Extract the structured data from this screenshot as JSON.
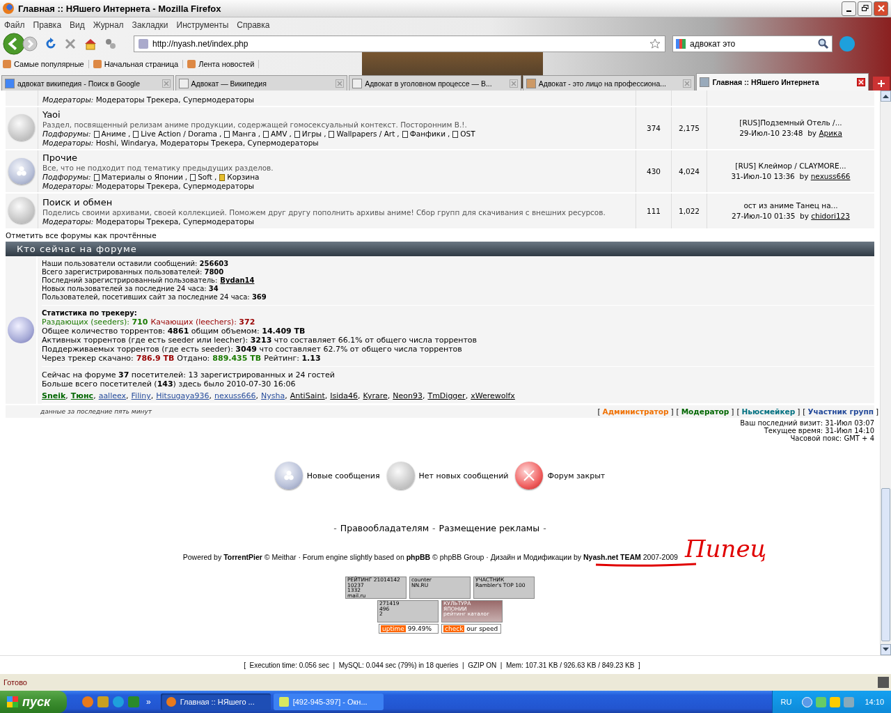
{
  "window": {
    "title": "Главная :: НЯшего Интернета - Mozilla Firefox"
  },
  "menu": [
    "Файл",
    "Правка",
    "Вид",
    "Журнал",
    "Закладки",
    "Инструменты",
    "Справка"
  ],
  "address": "http://nyash.net/index.php",
  "search": {
    "value": "адвокат это"
  },
  "bookmarks": [
    "Самые популярные",
    "Начальная страница",
    "Лента новостей"
  ],
  "tabs": [
    {
      "label": "адвокат википедия - Поиск в Google",
      "selected": false
    },
    {
      "label": "Адвокат — Википедия",
      "selected": false
    },
    {
      "label": "Адвокат в уголовном процессе — В...",
      "selected": false
    },
    {
      "label": "Адвокат - это лицо на профессиона...",
      "selected": false
    },
    {
      "label": "Главная :: НЯшего Интернета",
      "selected": true
    }
  ],
  "partial_row": {
    "moderators_label": "Модераторы:",
    "moderators": "Модераторы Трекера, Супермодераторы"
  },
  "forums": [
    {
      "unread": false,
      "title": "Yaoi",
      "description": "Раздел, посвященный релизам аниме продукции, содержащей гомосексуальный контекст. Посторонним В.!.",
      "subforums_label": "Подфорумы:",
      "subforums": [
        {
          "name": "Аниме",
          "sep": ",",
          "kind": "doc"
        },
        {
          "name": "Live Action / Dorama",
          "sep": ",",
          "kind": "doc"
        },
        {
          "name": "Манга",
          "sep": ",",
          "kind": "doc"
        },
        {
          "name": "AMV",
          "sep": ",",
          "kind": "doc"
        },
        {
          "name": "Игры",
          "sep": ",",
          "kind": "doc"
        },
        {
          "name": "Wallpapers / Art",
          "sep": ",",
          "kind": "doc"
        },
        {
          "name": "Фанфики",
          "sep": ",",
          "kind": "doc"
        },
        {
          "name": "OST",
          "kind": "doc"
        }
      ],
      "moderators_label": "Модераторы:",
      "moderators": "Hoshi, Windarya, Модераторы Трекера, Супермодераторы",
      "topics": "374",
      "posts": "2,175",
      "last_title": "[RUS]Подземный Отель /...",
      "last_date": "29-Июл-10 23:48",
      "last_by": "by",
      "last_author": "Арика"
    },
    {
      "unread": true,
      "title": "Прочие",
      "description": "Все, что не подходит под тематику предыдущих разделов.",
      "subforums_label": "Подфорумы:",
      "subforums": [
        {
          "name": "Материалы о Японии",
          "sep": ",",
          "kind": "doc"
        },
        {
          "name": "Soft",
          "sep": ",",
          "kind": "doc"
        },
        {
          "name": "Корзина",
          "kind": "bin"
        }
      ],
      "moderators_label": "Модераторы:",
      "moderators": "Модераторы Трекера, Супермодераторы",
      "topics": "430",
      "posts": "4,024",
      "last_title": "[RUS] Клеймор / CLAYMORE...",
      "last_date": "31-Июл-10 13:36",
      "last_by": "by",
      "last_author": "nexuss666"
    },
    {
      "unread": false,
      "title": "Поиск и обмен",
      "description": "Поделись своими архивами, своей коллекцией. Поможем друг другу пополнить архивы аниме! Сбор групп для скачивания с внешних ресурсов.",
      "moderators_label": "Модераторы:",
      "moderators": "Модераторы Трекера, Супермодераторы",
      "topics": "111",
      "posts": "1,022",
      "last_title": "ост из аниме Танец на...",
      "last_date": "27-Июл-10 01:35",
      "last_by": "by",
      "last_author": "chidori123"
    }
  ],
  "mark_read": "Отметить все форумы как прочтённые",
  "online": {
    "title": "Кто сейчас на форуме",
    "stats": [
      {
        "text": "Наши пользователи оставили сообщений: **256603**"
      },
      {
        "text": "Всего зарегистрированных пользователей: **7800**"
      },
      {
        "text": "Последний зарегистрированный пользователь:",
        "link": "Bydan14"
      },
      {
        "text": "Новых пользователей за последние 24 часа: **34**"
      },
      {
        "text": "Пользователей, посетивших сайт за последние 24 часа: **369**"
      }
    ],
    "tracker_title": "Статистика по трекеру:",
    "tracker": [
      [
        {
          "text": "Раздающих (seeders): **710**",
          "color": "#1a7a00"
        },
        {
          "text": "Качающих (leechers): **372**",
          "color": "#990000"
        }
      ],
      [
        {
          "text": "Общее количество торрентов: **4861** общим объемом: **14.409 TB**",
          "color": "#000000"
        }
      ],
      [
        {
          "text": "Активных торрентов (где есть seeder или leecher): **3213** что составляет 66.1% от общего числа торрентов",
          "color": "#000000"
        }
      ],
      [
        {
          "text": "Поддерживаемых торрентов (где есть seeder): **3049** что составляет 62.7% от общего числа торрентов",
          "color": "#000000"
        }
      ],
      [
        {
          "text": "Через трекер скачано:",
          "color": "#000000"
        },
        {
          "text": "**786.9 TB**",
          "color": "#990000"
        },
        {
          "text": "Отдано:",
          "color": "#000000"
        },
        {
          "text": "**889.435 TB**",
          "color": "#1a7a00"
        },
        {
          "text": "Рейтинг: **1.13**",
          "color": "#000000"
        }
      ]
    ],
    "presence": [
      "Сейчас на форуме **37** посетителей: 13 зарегистрированных и 24 гостей",
      "Больше всего посетителей (**143**) здесь было 2010-07-30 16:06"
    ],
    "users": [
      {
        "name": "Sneik",
        "sep": ",",
        "color": "#006600",
        "bold": true
      },
      {
        "name": "Тюнс",
        "sep": ",",
        "color": "#006600",
        "bold": true
      },
      {
        "name": "aalleex",
        "sep": ",",
        "color": "#244a9a",
        "bold": false
      },
      {
        "name": "Filiny",
        "sep": ",",
        "color": "#244a9a",
        "bold": false
      },
      {
        "name": "Hitsugaya936",
        "sep": ",",
        "color": "#244a9a",
        "bold": false
      },
      {
        "name": "nexuss666",
        "sep": ",",
        "color": "#244a9a",
        "bold": false
      },
      {
        "name": "Nysha",
        "sep": ",",
        "color": "#244a9a",
        "bold": false
      },
      {
        "name": "AntiSaint",
        "sep": ",",
        "color": "#000000",
        "bold": false
      },
      {
        "name": "Isida46",
        "sep": ",",
        "color": "#000000",
        "bold": false
      },
      {
        "name": "Kyrare",
        "sep": ",",
        "color": "#000000",
        "bold": false
      },
      {
        "name": "Neon93",
        "sep": ",",
        "color": "#000000",
        "bold": false
      },
      {
        "name": "TmDigger",
        "sep": ",",
        "color": "#000000",
        "bold": false
      },
      {
        "name": "xWerewolfx",
        "color": "#000000",
        "bold": false
      }
    ],
    "note": "данные за последние пять минут",
    "legend": [
      {
        "before": "[",
        "label": "Администратор",
        "after": "]",
        "color": "#f07000"
      },
      {
        "before": "[",
        "label": "Модератор",
        "after": "]",
        "color": "#006600"
      },
      {
        "before": "[",
        "label": "Ньюсмейкер",
        "after": "]",
        "color": "#007080"
      },
      {
        "before": "[",
        "label": "Участник групп",
        "after": "]",
        "color": "#244a9a"
      }
    ]
  },
  "visit": [
    "Ваш последний визит: 31-Июл 03:07",
    "Текущее время: 31-Июл 14:10",
    "Часовой пояс: GMT + 4"
  ],
  "icon_legend": [
    {
      "label": "Новые сообщения",
      "kind": "new"
    },
    {
      "label": "Нет новых сообщений",
      "kind": "none"
    },
    {
      "label": "Форум закрыт",
      "kind": "locked"
    }
  ],
  "footer_links": [
    {
      "text": "-",
      "kind": "sep"
    },
    {
      "text": "Правообладателям",
      "kind": "link"
    },
    {
      "text": "-",
      "kind": "sep"
    },
    {
      "text": "Размещение рекламы",
      "kind": "link"
    },
    {
      "text": "-",
      "kind": "sep"
    }
  ],
  "powered": "Powered by **TorrentPier** © Meithar · Forum engine slightly based on **phpBB** © phpBB Group · Дизайн и Модификации by **Nyash.net TEAM** 2007-2009",
  "annotation": "Пипец",
  "counters": [
    [
      {
        "kind": "plain",
        "texts": [
          "РЕЙТИНГ 21014142",
          "10237",
          "1332",
          "mail.ru"
        ]
      },
      {
        "kind": "plain",
        "texts": [
          "counter",
          "NN.RU"
        ]
      },
      {
        "kind": "plain",
        "texts": [
          "УЧАСТНИК",
          "Rambler's TOP 100"
        ]
      }
    ],
    [
      {
        "kind": "plain",
        "texts": [
          "271419",
          "496",
          "2"
        ]
      },
      {
        "kind": "photo",
        "texts": [
          "КУЛЬТУРА",
          "ЯПОНИИ",
          "рейтинг каталог"
        ]
      }
    ],
    [
      {
        "kind": "tag",
        "texts": [
          "uptime",
          "99.49%"
        ]
      },
      {
        "kind": "tag",
        "texts": [
          "check",
          "our speed"
        ]
      }
    ]
  ],
  "exec": "[  Execution time: 0.056 sec  |  MySQL: 0.044 sec (79%) in 18 queries  |  GZIP ON  |  Mem: 107.31 KB / 926.63 KB / 849.23 KB  ]",
  "status": "Готово",
  "taskbar": {
    "start": "пуск",
    "more": "»",
    "tasks": [
      {
        "label": "Главная :: НЯшего ...",
        "selected": true
      },
      {
        "label": "[492-945-397] - Окн...",
        "selected": false
      }
    ],
    "lang": "RU",
    "clock": "14:10"
  }
}
